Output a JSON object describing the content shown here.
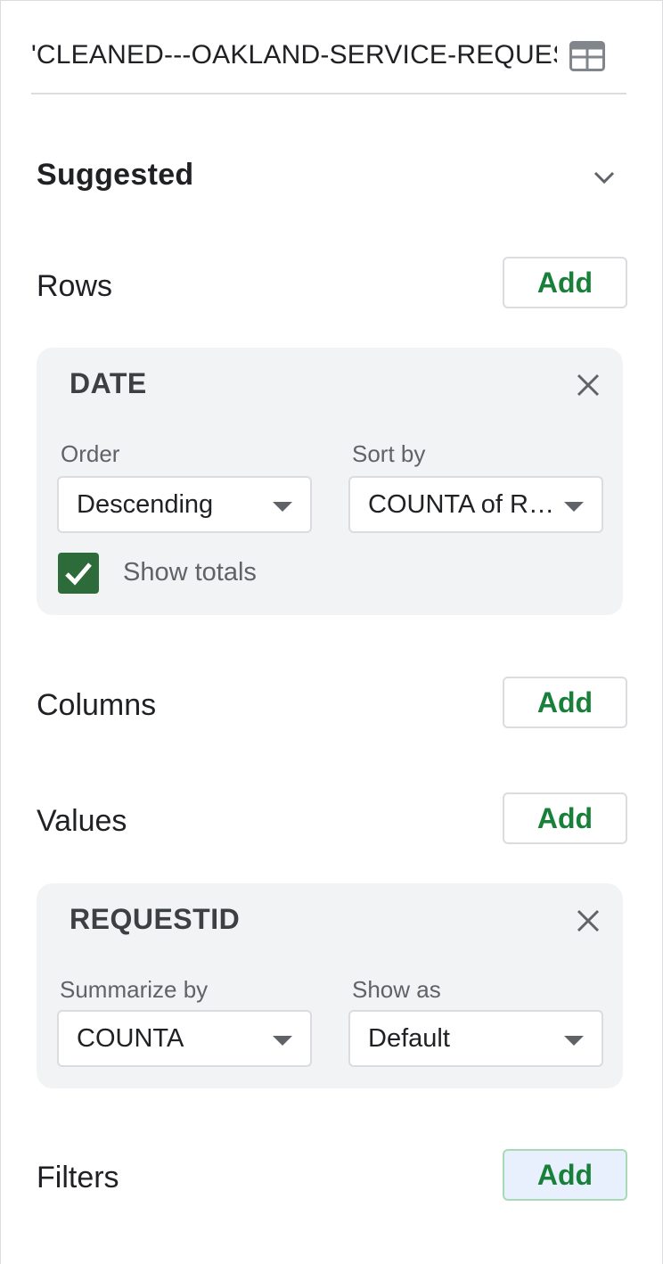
{
  "source": {
    "range_label": "'CLEANED---OAKLAND-SERVICE-REQUES",
    "range_icon": "grid-icon"
  },
  "suggested": {
    "label": "Suggested",
    "icon": "chevron-down-icon"
  },
  "rows": {
    "label": "Rows",
    "add_label": "Add",
    "field": {
      "name": "DATE",
      "order_label": "Order",
      "order_value": "Descending",
      "sort_label": "Sort by",
      "sort_value": "COUNTA of RE…",
      "show_totals_label": "Show totals",
      "show_totals_checked": true
    }
  },
  "columns": {
    "label": "Columns",
    "add_label": "Add"
  },
  "values": {
    "label": "Values",
    "add_label": "Add",
    "field": {
      "name": "REQUESTID",
      "summarize_label": "Summarize by",
      "summarize_value": "COUNTA",
      "showas_label": "Show as",
      "showas_value": "Default"
    }
  },
  "filters": {
    "label": "Filters",
    "add_label": "Add"
  },
  "colors": {
    "accent_green": "#188038",
    "checkbox_green": "#2e6b3a",
    "card_bg": "#f1f3f4",
    "focus_bg": "#e8f0fe"
  }
}
